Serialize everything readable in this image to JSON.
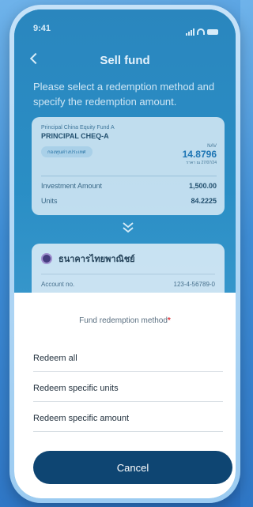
{
  "status": {
    "time": "9:41"
  },
  "header": {
    "title": "Sell fund"
  },
  "instructions": "Please select a redemption method and specify the redemption amount.",
  "fund": {
    "subtitle": "Principal China Equity Fund A",
    "name": "PRINCIPAL CHEQ-A",
    "tag": "กองทุนต่างประเทศ",
    "nav_label": "NAV",
    "nav_value": "14.8796",
    "nav_date": "ราคา ณ 27/07/24",
    "investment_label": "Investment Amount",
    "investment_value": "1,500.00",
    "units_label": "Units",
    "units_value": "84.2225"
  },
  "bank": {
    "name": "ธนาคารไทยพาณิชย์",
    "account_label": "Account no.",
    "account_value": "123-4-56789-0"
  },
  "sheet": {
    "title": "Fund redemption method",
    "required_mark": "*",
    "options": [
      "Redeem all",
      "Redeem specific units",
      "Redeem specific amount"
    ],
    "cancel_label": "Cancel"
  }
}
